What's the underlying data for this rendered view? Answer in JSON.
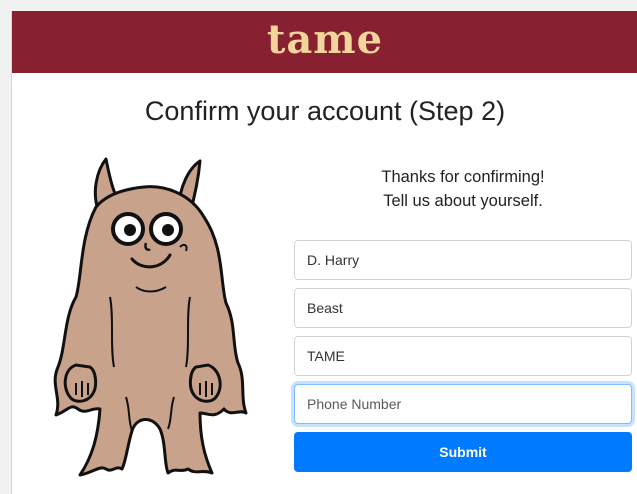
{
  "brand": {
    "logo_text": "tame",
    "bar_color": "#872031",
    "logo_color": "#f1d59a"
  },
  "page": {
    "title": "Confirm your account (Step 2)"
  },
  "intro": {
    "line1": "Thanks for confirming!",
    "line2": "Tell us about yourself."
  },
  "mascot": {
    "icon": "furry-monster-mascot-illustration"
  },
  "form": {
    "first_name": {
      "value": "D. Harry",
      "placeholder": ""
    },
    "last_name": {
      "value": "Beast",
      "placeholder": ""
    },
    "company": {
      "value": "TAME",
      "placeholder": ""
    },
    "phone": {
      "value": "",
      "placeholder": "Phone Number"
    },
    "submit_label": "Submit",
    "submit_color": "#007bff"
  }
}
